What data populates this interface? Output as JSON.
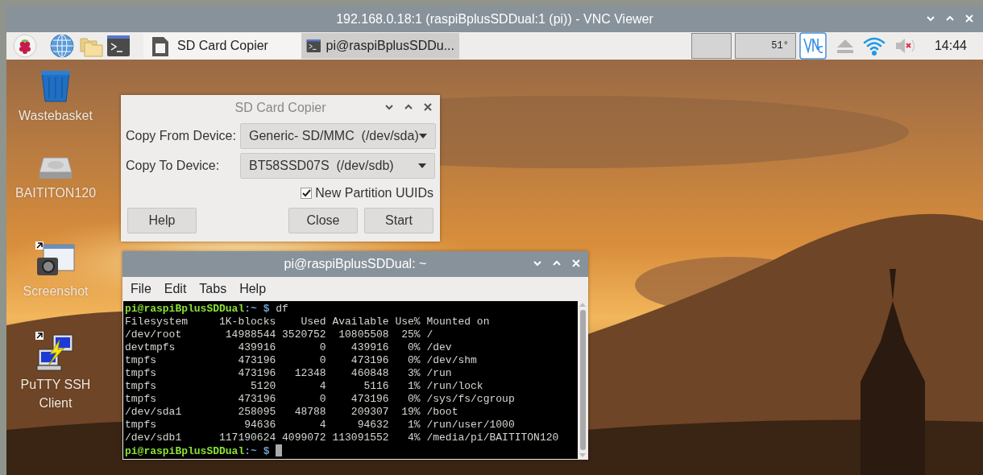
{
  "window": {
    "title": "192.168.0.18:1 (raspiBplusSDDual:1 (pi)) - VNC Viewer"
  },
  "taskbar": {
    "launchers": [
      {
        "kind": "raspberry"
      },
      {
        "kind": "globe"
      },
      {
        "kind": "folder"
      },
      {
        "kind": "terminal"
      }
    ],
    "tasks": [
      {
        "kind": "sdcard",
        "label": "SD Card Copier",
        "selected": false
      },
      {
        "kind": "terminal",
        "label": "pi@raspiBplusSDDu...",
        "selected": true
      }
    ],
    "temperature": "51°",
    "clock": "14:44"
  },
  "desktop_icons": [
    {
      "kind": "wastebasket",
      "label": "Wastebasket"
    },
    {
      "kind": "drive",
      "label": "BAITITON120"
    },
    {
      "kind": "screenshot",
      "label": "Screenshot"
    },
    {
      "kind": "putty",
      "label": "PuTTY SSH Client"
    }
  ],
  "sd_card_copier": {
    "title": "SD Card Copier",
    "fields": [
      {
        "label": "Copy From Device:",
        "value": "Generic- SD/MMC  (/dev/sda)"
      },
      {
        "label": "Copy To Device:",
        "value": "BT58SSD07S  (/dev/sdb)"
      }
    ],
    "checkbox": {
      "label": "New Partition UUIDs",
      "checked": true
    },
    "buttons": [
      "Help",
      "Close",
      "Start"
    ]
  },
  "terminal": {
    "title": "pi@raspiBplusSDDual: ~",
    "menu": [
      "File",
      "Edit",
      "Tabs",
      "Help"
    ],
    "lines": [
      {
        "kind": "prompt",
        "user": "pi@raspiBplusSDDual",
        "path": ":~",
        "symbol": " $ ",
        "command": "df"
      },
      {
        "kind": "output",
        "text": "Filesystem     1K-blocks    Used Available Use% Mounted on"
      },
      {
        "kind": "output",
        "text": "/dev/root       14988544 3520752  10805508  25% /"
      },
      {
        "kind": "output",
        "text": "devtmpfs          439916       0    439916   0% /dev"
      },
      {
        "kind": "output",
        "text": "tmpfs             473196       0    473196   0% /dev/shm"
      },
      {
        "kind": "output",
        "text": "tmpfs             473196   12348    460848   3% /run"
      },
      {
        "kind": "output",
        "text": "tmpfs               5120       4      5116   1% /run/lock"
      },
      {
        "kind": "output",
        "text": "tmpfs             473196       0    473196   0% /sys/fs/cgroup"
      },
      {
        "kind": "output",
        "text": "/dev/sda1         258095   48788    209307  19% /boot"
      },
      {
        "kind": "output",
        "text": "tmpfs              94636       4     94632   1% /run/user/1000"
      },
      {
        "kind": "output",
        "text": "/dev/sdb1      117190624 4099072 113091552   4% /media/pi/BAITITON120"
      },
      {
        "kind": "prompt",
        "user": "pi@raspiBplusSDDual",
        "path": ":~",
        "symbol": " $ ",
        "cursor": true
      }
    ]
  }
}
